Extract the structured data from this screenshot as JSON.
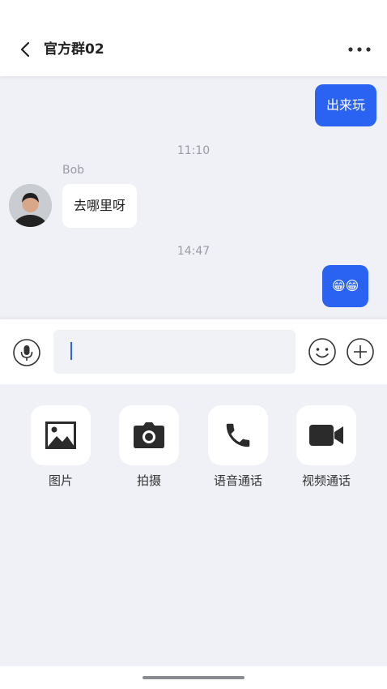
{
  "header": {
    "title": "官方群02",
    "back_icon": "chevron-left-icon",
    "more_icon": "more-dots-icon"
  },
  "messages": [
    {
      "type": "outgoing",
      "text": "出来玩"
    },
    {
      "type": "timestamp",
      "text": "11:10"
    },
    {
      "type": "incoming",
      "sender": "Bob",
      "text": "去哪里呀",
      "avatar": "avatar-photo"
    },
    {
      "type": "timestamp",
      "text": "14:47"
    },
    {
      "type": "outgoing",
      "text": "😁😁"
    }
  ],
  "input_bar": {
    "value": "",
    "voice_icon": "microphone-icon",
    "emoji_icon": "smiley-icon",
    "plus_icon": "plus-icon"
  },
  "tools": [
    {
      "label": "图片",
      "icon": "image-icon"
    },
    {
      "label": "拍摄",
      "icon": "camera-icon"
    },
    {
      "label": "语音通话",
      "icon": "phone-icon"
    },
    {
      "label": "视频通话",
      "icon": "video-camera-icon"
    }
  ],
  "colors": {
    "accent": "#2a62f2",
    "background": "#eff1f6",
    "surface": "#ffffff"
  }
}
